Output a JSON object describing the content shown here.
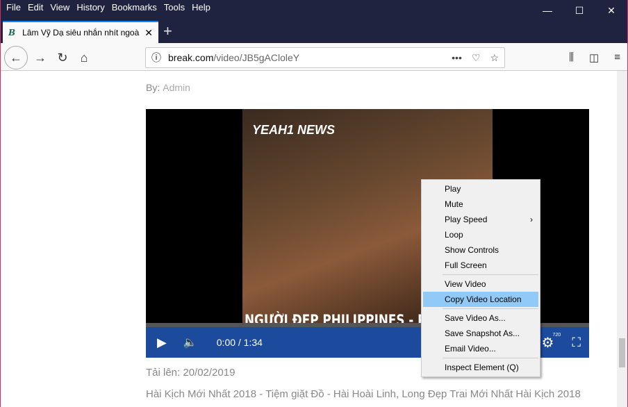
{
  "menu": [
    "File",
    "Edit",
    "View",
    "History",
    "Bookmarks",
    "Tools",
    "Help"
  ],
  "menu_access": [
    "F",
    "E",
    "V",
    "s",
    "B",
    "T",
    "H"
  ],
  "tab": {
    "title": "Lâm Vỹ Dạ siêu nhắn nhít ngoà",
    "favicon": "B"
  },
  "url": {
    "domain": "break.com",
    "path": "/video/JB5gACloleY"
  },
  "page": {
    "by_label": "By:",
    "author": "Admin",
    "uploaded": "Tải lên: 20/02/2019",
    "description": "Hài Kịch Mới Nhất 2018 - Tiệm giặt Đồ - Hài Hoài Linh, Long Đẹp Trai Mới Nhất Hài Kịch 2018"
  },
  "video": {
    "logo": "YEAH1 NEWS",
    "caption": "NGƯỜI ĐẸP PHILIPPINES - PIA W",
    "time": "0:00 / 1:34",
    "quality": "720",
    "progress": 0
  },
  "context_menu": {
    "items": [
      "Play",
      "Mute",
      "Play Speed",
      "Loop",
      "Show Controls",
      "Full Screen",
      "View Video",
      "Copy Video Location",
      "Save Video As...",
      "Save Snapshot As...",
      "Email Video...",
      "Inspect Element (Q)"
    ],
    "highlighted": "Copy Video Location",
    "highlight_color": "#91c9f7"
  }
}
